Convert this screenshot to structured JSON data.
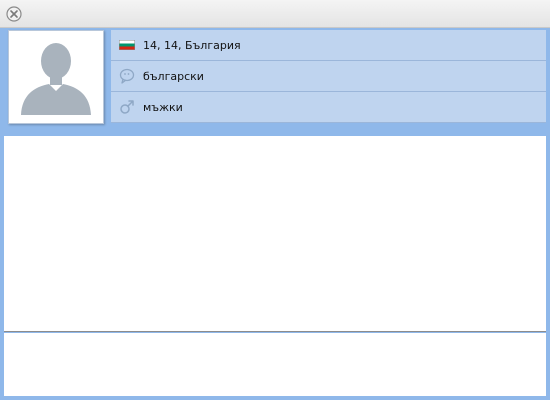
{
  "window": {
    "close_icon": "close-circle-icon"
  },
  "profile": {
    "avatar_icon": "default-user-avatar-icon",
    "location": {
      "icon": "bulgaria-flag-icon",
      "text": "14, 14, България"
    },
    "language": {
      "icon": "speech-bubble-icon",
      "text": "български"
    },
    "gender": {
      "icon": "male-symbol-icon",
      "text": "мъжки"
    }
  },
  "colors": {
    "frame": "#8fb8ea",
    "info_row": "#bfd4ef",
    "flag_white": "#ffffff",
    "flag_green": "#00966e",
    "flag_red": "#d62612"
  }
}
